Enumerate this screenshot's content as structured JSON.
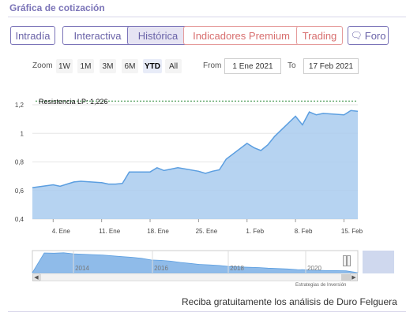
{
  "section_title": "Gráfica de cotización",
  "tabs": [
    {
      "label": "Intradía"
    },
    {
      "label": "Interactiva"
    },
    {
      "label": "Histórica"
    },
    {
      "label": "Indicadores Premium"
    },
    {
      "label": "Trading"
    },
    {
      "label": "Foro"
    }
  ],
  "zoom": {
    "label": "Zoom",
    "buttons": [
      "1W",
      "1M",
      "3M",
      "6M",
      "YTD",
      "All"
    ],
    "selected": "YTD",
    "from_label": "From",
    "from_value": "1 Ene 2021",
    "to_label": "To",
    "to_value": "17 Feb 2021"
  },
  "colors": {
    "accent": "#7b74b8",
    "premium": "#d86f6f",
    "series_line": "#5b9ee0",
    "series_fill": "#a9cbef",
    "resistance": "#2e8b3a"
  },
  "chart_data": {
    "type": "area",
    "ylim": [
      0.4,
      1.2
    ],
    "yticks": [
      "0,4",
      "0,6",
      "0,8",
      "1",
      "1,2"
    ],
    "xticks": [
      "4. Ene",
      "11. Ene",
      "18. Ene",
      "25. Ene",
      "1. Feb",
      "8. Feb",
      "15. Feb"
    ],
    "grid": true,
    "annotation": "Resistencia LP: 1,226",
    "resistance": 1.226,
    "x": [
      "2021-01-01",
      "2021-01-04",
      "2021-01-05",
      "2021-01-06",
      "2021-01-07",
      "2021-01-08",
      "2021-01-11",
      "2021-01-12",
      "2021-01-13",
      "2021-01-14",
      "2021-01-15",
      "2021-01-18",
      "2021-01-19",
      "2021-01-20",
      "2021-01-21",
      "2021-01-22",
      "2021-01-25",
      "2021-01-26",
      "2021-01-27",
      "2021-01-28",
      "2021-01-29",
      "2021-02-01",
      "2021-02-02",
      "2021-02-03",
      "2021-02-04",
      "2021-02-05",
      "2021-02-08",
      "2021-02-09",
      "2021-02-10",
      "2021-02-11",
      "2021-02-12",
      "2021-02-15",
      "2021-02-16",
      "2021-02-17"
    ],
    "values": [
      0.62,
      0.64,
      0.63,
      0.645,
      0.66,
      0.665,
      0.655,
      0.645,
      0.645,
      0.65,
      0.73,
      0.73,
      0.76,
      0.74,
      0.75,
      0.76,
      0.735,
      0.72,
      0.735,
      0.745,
      0.82,
      0.93,
      0.9,
      0.88,
      0.92,
      0.98,
      1.12,
      1.06,
      1.15,
      1.13,
      1.14,
      1.13,
      1.16,
      1.155
    ],
    "navigator_years": [
      "2014",
      "2016",
      "2018",
      "2020"
    ],
    "credits": "Estrategias de Inversión"
  },
  "footer_text": "Reciba gratuitamente los análisis de Duro Felguera"
}
